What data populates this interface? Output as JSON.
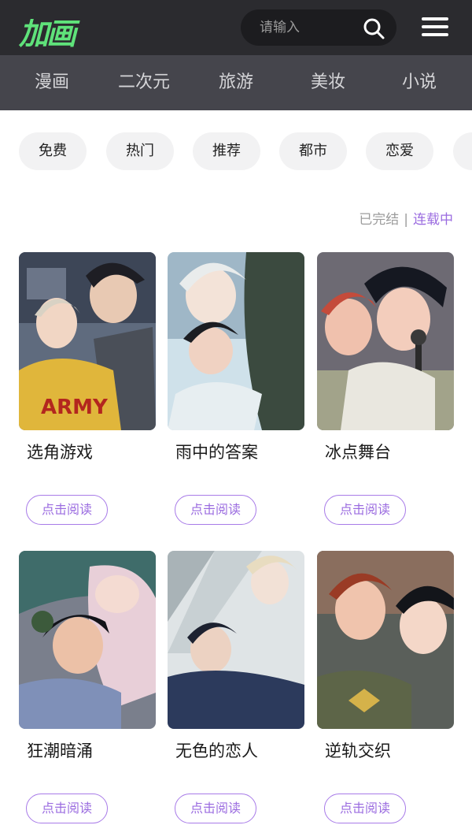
{
  "header": {
    "logo_text": "加画",
    "search_placeholder": "请输入",
    "icons": {
      "search": "search-icon",
      "menu": "menu-icon"
    },
    "colors": {
      "logo": "#5fe27a",
      "topbar": "#2b2b2f",
      "catbar": "#45454c"
    }
  },
  "categories": [
    "漫画",
    "二次元",
    "旅游",
    "美妆",
    "小说"
  ],
  "tags": [
    "免费",
    "热门",
    "推荐",
    "都市",
    "恋爱"
  ],
  "status": {
    "completed": "已完结",
    "separator": "|",
    "ongoing": "连载中",
    "ongoing_color": "#9b6ce0"
  },
  "comics": [
    {
      "title": "选角游戏",
      "button": "点击阅读"
    },
    {
      "title": "雨中的答案",
      "button": "点击阅读"
    },
    {
      "title": "冰点舞台",
      "button": "点击阅读"
    },
    {
      "title": "狂潮暗涌",
      "button": "点击阅读"
    },
    {
      "title": "无色的恋人",
      "button": "点击阅读"
    },
    {
      "title": "逆轨交织",
      "button": "点击阅读"
    }
  ]
}
